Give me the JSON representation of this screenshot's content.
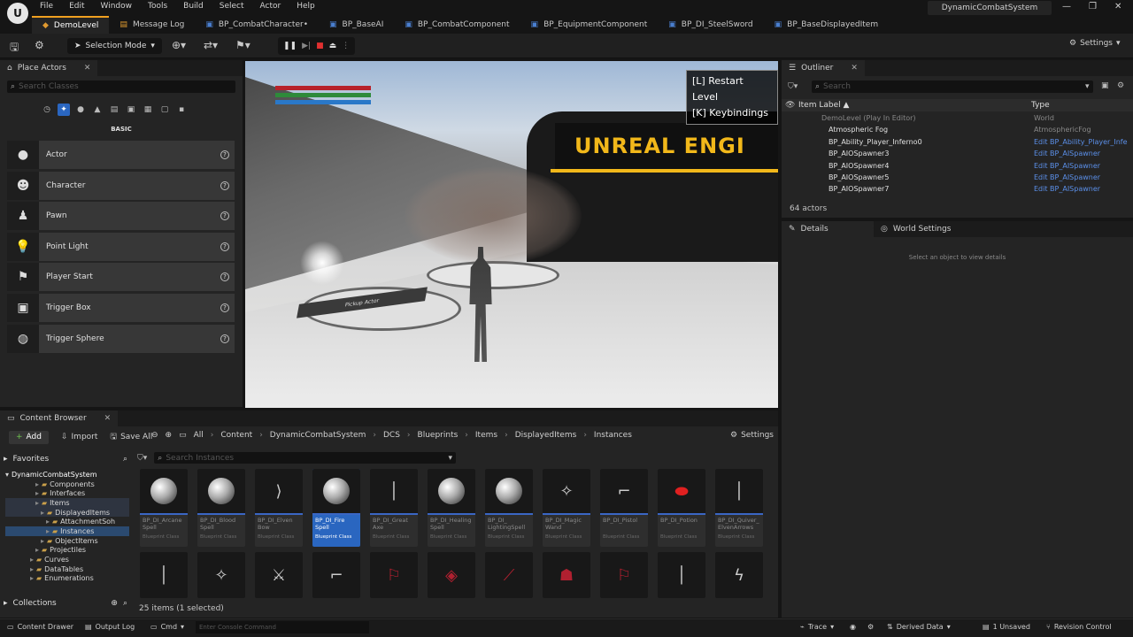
{
  "menu": [
    "File",
    "Edit",
    "Window",
    "Tools",
    "Build",
    "Select",
    "Actor",
    "Help"
  ],
  "project_name": "DynamicCombatSystem",
  "window_controls": [
    "—",
    "❐",
    "✕"
  ],
  "tabs": [
    {
      "label": "DemoLevel",
      "icon": "level-icon",
      "active": true
    },
    {
      "label": "Message Log",
      "icon": "log-icon",
      "active": false
    },
    {
      "label": "BP_CombatCharacter•",
      "icon": "blueprint-icon",
      "active": false
    },
    {
      "label": "BP_BaseAI",
      "icon": "blueprint-icon",
      "active": false
    },
    {
      "label": "BP_CombatComponent",
      "icon": "blueprint-icon",
      "active": false
    },
    {
      "label": "BP_EquipmentComponent",
      "icon": "blueprint-icon",
      "active": false
    },
    {
      "label": "BP_DI_SteelSword",
      "icon": "blueprint-icon",
      "active": false
    },
    {
      "label": "BP_BaseDisplayedItem",
      "icon": "blueprint-icon",
      "active": false
    }
  ],
  "toolbar": {
    "selection_mode": "Selection Mode",
    "settings": "Settings"
  },
  "place_actors": {
    "title": "Place Actors",
    "search_placeholder": "Search Classes",
    "category": "BASIC",
    "items": [
      "Actor",
      "Character",
      "Pawn",
      "Point Light",
      "Player Start",
      "Trigger Box",
      "Trigger Sphere"
    ]
  },
  "viewport": {
    "hud_lines": [
      "[L] Restart Level",
      "[K] Keybindings"
    ],
    "banner": "UNREAL ENGI",
    "pickup_label": "Pickup Actor"
  },
  "outliner": {
    "title": "Outliner",
    "search_placeholder": "Search",
    "col_label": "Item Label ▲",
    "col_type": "Type",
    "rows": [
      {
        "name": "DemoLevel (Play In Editor)",
        "type": "World",
        "dim": true,
        "indent": 0
      },
      {
        "name": "Atmospheric Fog",
        "type": "AtmosphericFog",
        "dim": false,
        "type_dim": true,
        "indent": 1
      },
      {
        "name": "BP_Ability_Player_Inferno0",
        "type": "Edit BP_Ability_Player_Infe",
        "dim": false,
        "indent": 1
      },
      {
        "name": "BP_AIOSpawner3",
        "type": "Edit BP_AISpawner",
        "dim": false,
        "indent": 1
      },
      {
        "name": "BP_AIOSpawner4",
        "type": "Edit BP_AISpawner",
        "dim": false,
        "indent": 1
      },
      {
        "name": "BP_AIOSpawner5",
        "type": "Edit BP_AISpawner",
        "dim": false,
        "indent": 1
      },
      {
        "name": "BP_AIOSpawner7",
        "type": "Edit BP_AISpawner",
        "dim": false,
        "indent": 1
      }
    ],
    "actor_count": "64 actors"
  },
  "details": {
    "tab": "Details",
    "tab2": "World Settings",
    "message": "Select an object to view details"
  },
  "content_browser": {
    "title": "Content Browser",
    "add": "Add",
    "import": "Import",
    "save_all": "Save All",
    "breadcrumbs": [
      "All",
      "Content",
      "DynamicCombatSystem",
      "DCS",
      "Blueprints",
      "Items",
      "DisplayedItems",
      "Instances"
    ],
    "settings": "Settings",
    "favorites": "Favorites",
    "root": "DynamicCombatSystem",
    "tree": [
      {
        "label": "Components",
        "level": 1,
        "state": ""
      },
      {
        "label": "Interfaces",
        "level": 1,
        "state": ""
      },
      {
        "label": "Items",
        "level": 1,
        "state": "hl"
      },
      {
        "label": "DisplayedItems",
        "level": 2,
        "state": "hl"
      },
      {
        "label": "AttachmentSoh",
        "level": 3,
        "state": ""
      },
      {
        "label": "Instances",
        "level": 3,
        "state": "sel"
      },
      {
        "label": "ObjectItems",
        "level": 2,
        "state": ""
      },
      {
        "label": "Projectiles",
        "level": 1,
        "state": ""
      },
      {
        "label": "Curves",
        "level": 0,
        "state": ""
      },
      {
        "label": "DataTables",
        "level": 0,
        "state": ""
      },
      {
        "label": "Enumerations",
        "level": 0,
        "state": ""
      }
    ],
    "collections": "Collections",
    "search_placeholder": "Search Instances",
    "assets": [
      {
        "name": "BP_DI_Arcane Spell",
        "cls": "Blueprint Class",
        "icon": "sphere",
        "selected": false
      },
      {
        "name": "BP_DI_Blood Spell",
        "cls": "Blueprint Class",
        "icon": "sphere",
        "selected": false
      },
      {
        "name": "BP_DI_Elven Bow",
        "cls": "Blueprint Class",
        "icon": "bow",
        "selected": false
      },
      {
        "name": "BP_DI_Fire Spell",
        "cls": "Blueprint Class",
        "icon": "sphere",
        "selected": true
      },
      {
        "name": "BP_DI_Great Axe",
        "cls": "Blueprint Class",
        "icon": "axe",
        "selected": false
      },
      {
        "name": "BP_DI_Healing Spell",
        "cls": "Blueprint Class",
        "icon": "sphere",
        "selected": false
      },
      {
        "name": "BP_DI_ LightingSpell",
        "cls": "Blueprint Class",
        "icon": "sphere",
        "selected": false
      },
      {
        "name": "BP_DI_Magic Wand",
        "cls": "Blueprint Class",
        "icon": "wand",
        "selected": false
      },
      {
        "name": "BP_DI_Pistol",
        "cls": "Blueprint Class",
        "icon": "pistol",
        "selected": false
      },
      {
        "name": "BP_DI_Potion",
        "cls": "Blueprint Class",
        "icon": "potion",
        "selected": false
      },
      {
        "name": "BP_DI_Quiver_ ElvenArrows",
        "cls": "Blueprint Class",
        "icon": "quiver",
        "selected": false
      }
    ],
    "item_count": "25 items (1 selected)"
  },
  "status": {
    "content_drawer": "Content Drawer",
    "output_log": "Output Log",
    "cmd": "Cmd",
    "console_placeholder": "Enter Console Command",
    "trace": "Trace",
    "derived_data": "Derived Data",
    "unsaved": "1 Unsaved",
    "revision": "Revision Control"
  }
}
